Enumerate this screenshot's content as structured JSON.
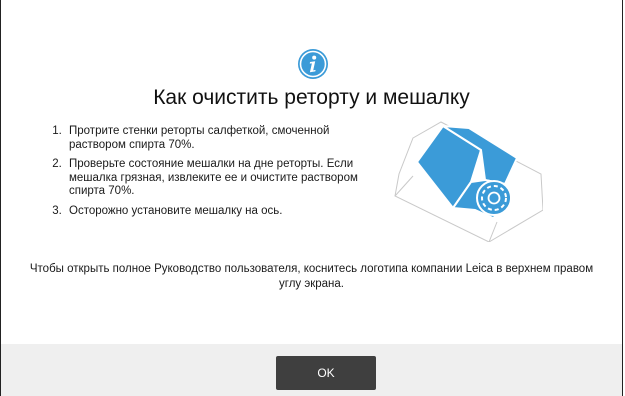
{
  "dialog": {
    "icon": "info-icon",
    "title": "Как очистить реторту и мешалку",
    "steps": [
      "Протрите стенки реторты салфеткой, смоченной раствором спирта 70%.",
      "Проверьте состояние мешалки на дне реторты. Если мешалка грязная, извлеките ее и очистите раствором спирта 70%.",
      "Осторожно установите мешалку на ось."
    ],
    "note": "Чтобы открыть полное Руководство пользователя, коснитесь логотипа компании Leica в верхнем правом углу экрана.",
    "ok_label": "OK"
  },
  "colors": {
    "accent": "#3b9bd8",
    "button": "#3f3f3f",
    "footer": "#efefef"
  }
}
